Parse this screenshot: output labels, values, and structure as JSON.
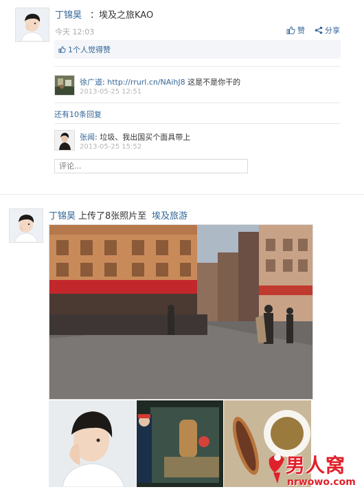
{
  "post1": {
    "author": "丁锦昊",
    "title": "：埃及之旅KAO",
    "time": "今天 12:03",
    "like_label": "赞",
    "share_label": "分享",
    "likes_text": "1个人觉得赞",
    "comments": [
      {
        "author": "徐广道",
        "sep": ":",
        "link": "http://rrurl.cn/NAihJ8",
        "text": "这是不是你干的",
        "time": "2013-05-25 12:51"
      },
      {
        "author": "张闻",
        "sep": ":",
        "text": "垃圾、我出国买个面具带上",
        "time": "2013-05-25 15:52"
      }
    ],
    "more_replies": "还有10条回复",
    "comment_placeholder": "评论..."
  },
  "post2": {
    "author": "丁锦昊",
    "action": "上传了8张照片至",
    "album": "埃及旅游"
  },
  "watermark": {
    "text_cn": "男人窝",
    "text_en": "nrwowo.com"
  },
  "colors": {
    "link": "#336699",
    "like_box": "#f3f5f8",
    "watermark_red": "#e0202a"
  },
  "icons": [
    "thumbs-up-icon",
    "share-icon",
    "watermark-logo-icon"
  ]
}
